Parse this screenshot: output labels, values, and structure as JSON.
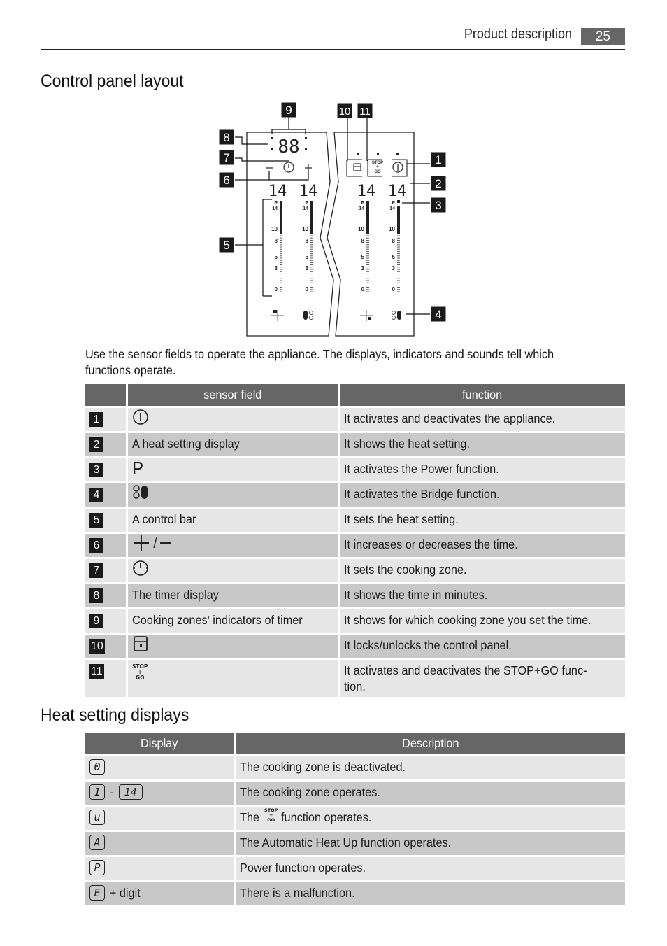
{
  "header": {
    "section_title": "Product description",
    "page_number": "25"
  },
  "control_panel": {
    "title": "Control panel layout",
    "diagram": {
      "callouts": [
        "1",
        "2",
        "3",
        "4",
        "5",
        "6",
        "7",
        "8",
        "9",
        "10",
        "11"
      ],
      "timer_display": "88",
      "zone_displays": [
        "14",
        "14",
        "14",
        "14"
      ],
      "scale_labels": [
        "P",
        "14",
        "10",
        "8",
        "5",
        "3",
        "0"
      ],
      "stop_go_label": [
        "STOP",
        "+",
        "GO"
      ]
    },
    "intro": "Use the sensor fields to operate the appliance. The displays, indicators and sounds tell which functions operate.",
    "table": {
      "headers": [
        "",
        "sensor field",
        "function"
      ],
      "rows": [
        {
          "num": "1",
          "icon": "power-icon",
          "field": "",
          "function": "It activates and deactivates the appliance."
        },
        {
          "num": "2",
          "icon": "",
          "field": "A heat setting display",
          "function": "It shows the heat setting."
        },
        {
          "num": "3",
          "icon": "power-function-p-icon",
          "field": "P",
          "function": "It activates the Power function."
        },
        {
          "num": "4",
          "icon": "bridge-icon",
          "field": "",
          "function": "It activates the Bridge function."
        },
        {
          "num": "5",
          "icon": "",
          "field": "A control bar",
          "function": "It sets the heat setting."
        },
        {
          "num": "6",
          "icon": "plus-minus-icon",
          "field": "+ / –",
          "function": "It increases or decreases the time."
        },
        {
          "num": "7",
          "icon": "timer-icon",
          "field": "",
          "function": "It sets the cooking zone."
        },
        {
          "num": "8",
          "icon": "",
          "field": "The timer display",
          "function": "It shows the time in minutes."
        },
        {
          "num": "9",
          "icon": "",
          "field": "Cooking zones' indicators of timer",
          "function": "It shows for which cooking zone you set the time."
        },
        {
          "num": "10",
          "icon": "lock-icon",
          "field": "",
          "function": "It locks/unlocks the control panel."
        },
        {
          "num": "11",
          "icon": "stop-go-icon",
          "field": "STOP + GO",
          "function": "It activates and deactivates the STOP+GO func-",
          "function_line2": "tion."
        }
      ]
    }
  },
  "heat_settings": {
    "title": "Heat setting displays",
    "table": {
      "headers": [
        "Display",
        "Description"
      ],
      "rows": [
        {
          "display": "0",
          "description": "The cooking zone is deactivated."
        },
        {
          "display_from": "1",
          "display_sep": "-",
          "display_to": "14",
          "description": "The cooking zone operates."
        },
        {
          "display": "u",
          "description_pre": "The",
          "description_post": "function operates."
        },
        {
          "display": "A",
          "description": "The Automatic Heat Up function operates."
        },
        {
          "display": "P",
          "description": "Power function operates."
        },
        {
          "display": "E",
          "display_suffix": "+ digit",
          "description": "There is a malfunction."
        }
      ]
    }
  }
}
